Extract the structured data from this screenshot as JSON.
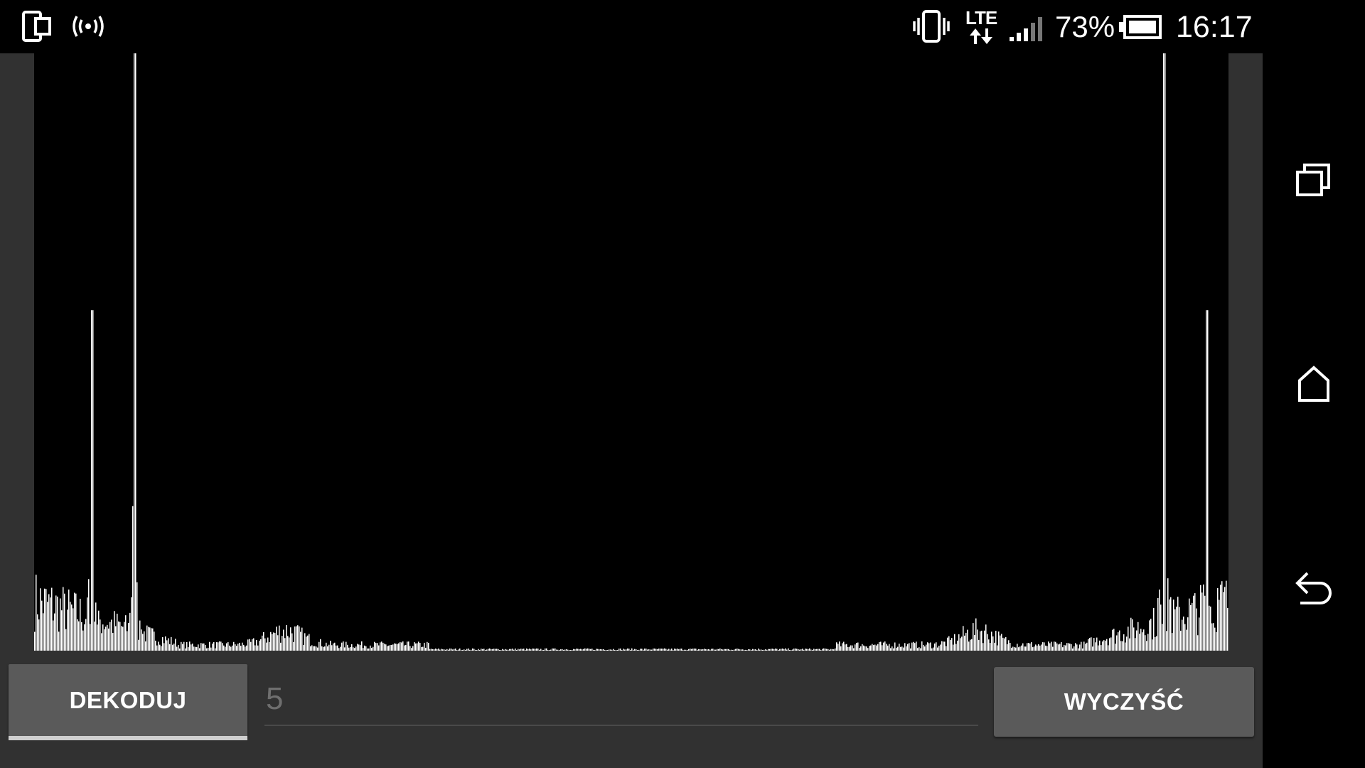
{
  "status_bar": {
    "left_icons": [
      "screen-mirror-icon",
      "wireless-broadcast-icon"
    ],
    "right_icons": [
      "vibrate-icon",
      "lte-data-icon",
      "signal-strength-icon",
      "battery-icon"
    ],
    "network_type": "LTE",
    "battery_percent": "73%",
    "battery_level": 0.73,
    "signal_bars": 3,
    "signal_bars_total": 5,
    "time": "16:17"
  },
  "spectrum": {
    "description_colors": {
      "background": "#000000",
      "bars": "#ffffff"
    },
    "peaks_fraction_of_height": [
      {
        "pos": 0.048,
        "level": 0.57
      },
      {
        "pos": 0.084,
        "level": 1.0
      },
      {
        "pos": 0.946,
        "level": 1.0
      },
      {
        "pos": 0.981,
        "level": 0.57
      }
    ]
  },
  "controls": {
    "decode_label": "DEKODUJ",
    "input_value": "",
    "input_placeholder": "5",
    "clear_label": "WYCZYŚĆ"
  },
  "nav_bar": {
    "buttons": [
      "recent-apps-icon",
      "home-icon",
      "back-icon"
    ]
  },
  "colors": {
    "app_background": "#313131",
    "button_background": "#5a5a5a",
    "status_bar": "#000000"
  }
}
